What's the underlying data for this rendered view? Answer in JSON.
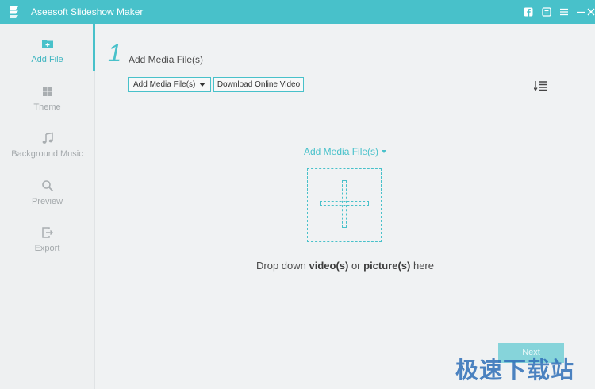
{
  "window": {
    "title": "Aseesoft Slideshow Maker",
    "controls": [
      "facebook-icon",
      "feedback-icon",
      "menu-icon",
      "minimize-icon",
      "close-icon"
    ]
  },
  "sidebar": {
    "items": [
      {
        "label": "Add File",
        "icon": "add-folder-icon",
        "active": true
      },
      {
        "label": "Theme",
        "icon": "theme-grid-icon",
        "active": false
      },
      {
        "label": "Background Music",
        "icon": "music-note-icon",
        "active": false
      },
      {
        "label": "Preview",
        "icon": "magnifier-icon",
        "active": false
      },
      {
        "label": "Export",
        "icon": "export-icon",
        "active": false
      }
    ]
  },
  "main": {
    "step_number": "1",
    "step_title": "Add Media File(s)",
    "toolbar": {
      "add_media_label": "Add Media File(s)",
      "download_label": "Download Online Video"
    },
    "center_link": "Add Media File(s)",
    "drop_text": {
      "prefix": "Drop down ",
      "video": "video(s)",
      "or": " or ",
      "picture": "picture(s)",
      "suffix": " here"
    },
    "next_label": "Next"
  },
  "watermark": "极速下载站",
  "colors": {
    "accent": "#48c1ca",
    "background": "#f0f2f3",
    "sidebar_inactive": "#a3a8ab"
  }
}
